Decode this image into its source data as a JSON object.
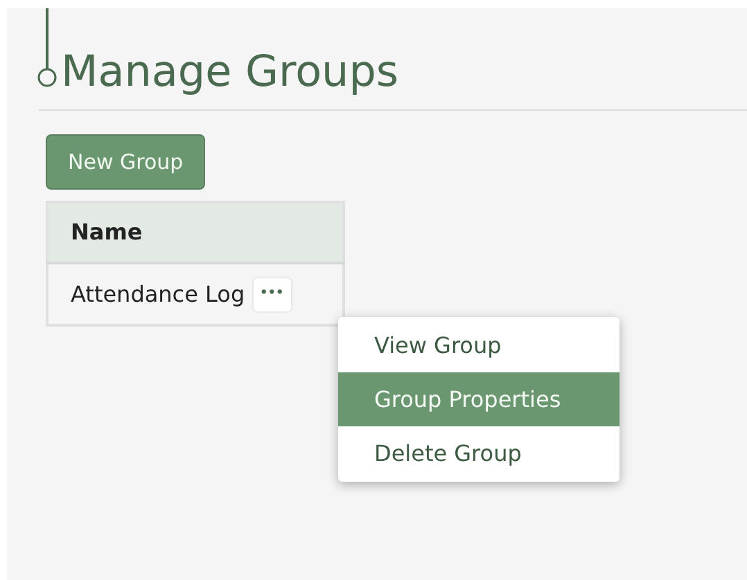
{
  "page": {
    "title": "Manage Groups"
  },
  "new_group_button": "New Group",
  "table": {
    "columns": [
      "Name"
    ],
    "rows": [
      {
        "name": "Attendance Log",
        "actions_label": "•••"
      }
    ]
  },
  "menu": {
    "items": [
      {
        "label": "View Group",
        "selected": false
      },
      {
        "label": "Group Properties",
        "selected": true
      },
      {
        "label": "Delete Group",
        "selected": false
      }
    ]
  }
}
